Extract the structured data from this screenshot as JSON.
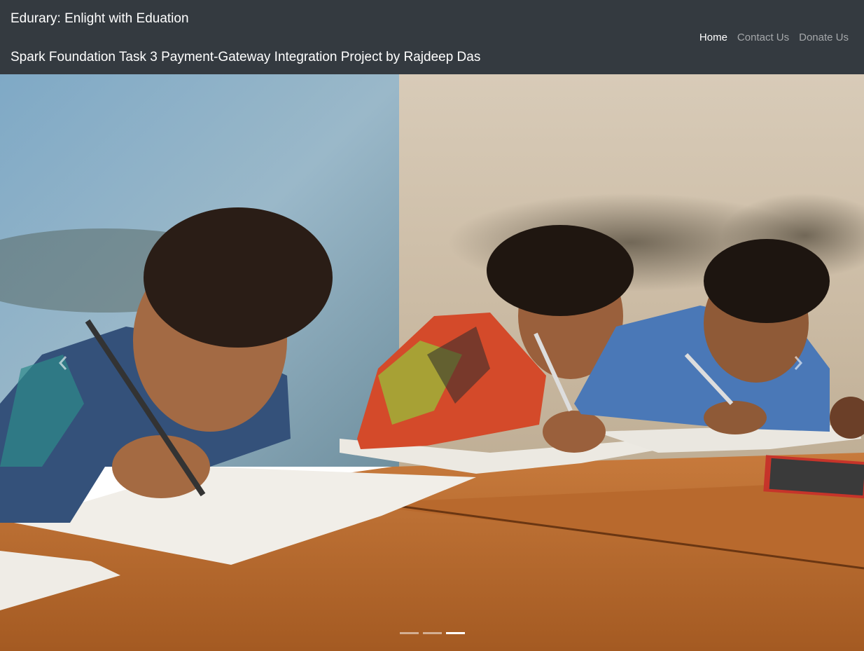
{
  "header": {
    "title": "Edurary: Enlight with Eduation",
    "subtitle": "Spark Foundation Task 3 Payment-Gateway Integration Project by Rajdeep Das"
  },
  "nav": {
    "items": [
      {
        "label": "Home",
        "active": true
      },
      {
        "label": "Contact Us",
        "active": false
      },
      {
        "label": "Donate Us",
        "active": false
      }
    ]
  },
  "carousel": {
    "slide_count": 3,
    "active_slide": 3,
    "prev_icon": "chevron-left-icon",
    "next_icon": "chevron-right-icon"
  },
  "colors": {
    "navbar_bg": "#343a40",
    "nav_active": "#ffffff",
    "nav_inactive": "#a3a5a8"
  }
}
